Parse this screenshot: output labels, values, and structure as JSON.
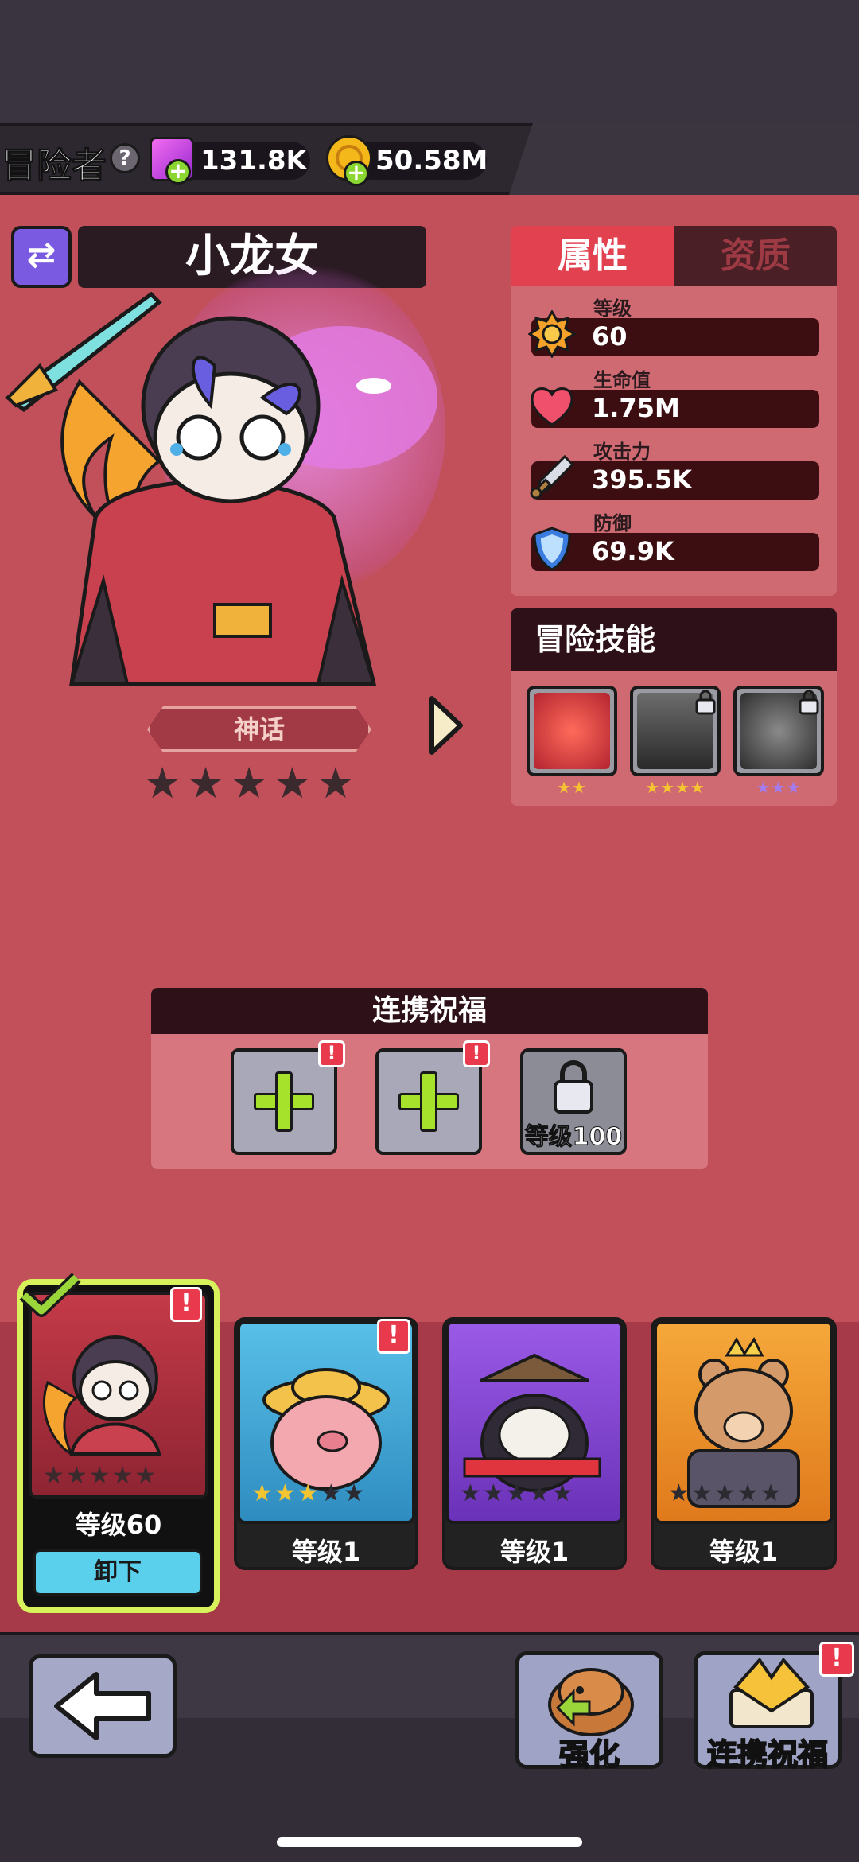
{
  "topbar": {
    "role_label": "冒险者",
    "help_icon": "help-icon",
    "gems": "131.8K",
    "gold": "50.58M"
  },
  "hero": {
    "name": "小龙女",
    "rarity": "神话",
    "stars_total": 5,
    "stars_filled": 0
  },
  "stats": {
    "tabs": [
      "属性",
      "资质"
    ],
    "active_tab": "属性",
    "items": [
      {
        "label": "等级",
        "value": "60",
        "icon": "level-badge-icon"
      },
      {
        "label": "生命值",
        "value": "1.75M",
        "icon": "heart-icon"
      },
      {
        "label": "攻击力",
        "value": "395.5K",
        "icon": "sword-icon"
      },
      {
        "label": "防御",
        "value": "69.9K",
        "icon": "shield-icon"
      }
    ]
  },
  "skills": {
    "title": "冒险技能",
    "items": [
      {
        "name": "dragon-skill",
        "locked": false,
        "stars": 2,
        "star_color": "#f5c431"
      },
      {
        "name": "spikes-skill",
        "locked": true,
        "stars": 4,
        "star_color": "#f5c431"
      },
      {
        "name": "bird-skill",
        "locked": true,
        "stars": 3,
        "star_color": "#a27cf0"
      }
    ]
  },
  "synergy": {
    "title": "连携祝福",
    "slots": [
      {
        "type": "add",
        "alert": "!"
      },
      {
        "type": "add",
        "alert": "!"
      },
      {
        "type": "locked",
        "label": "等级100"
      }
    ]
  },
  "roster": [
    {
      "name": "xiaolongnv",
      "level": "等级60",
      "stars_filled": 0,
      "selected": true,
      "alert": "!",
      "action": "卸下",
      "color": "#c43a48"
    },
    {
      "name": "pig",
      "level": "等级1",
      "stars_filled": 3,
      "selected": false,
      "alert": "!",
      "color": "#3fa7d8"
    },
    {
      "name": "panda",
      "level": "等级1",
      "stars_filled": 0,
      "selected": false,
      "color": "#8a4ed6"
    },
    {
      "name": "bear",
      "level": "等级1",
      "stars_filled": 0,
      "selected": false,
      "color": "#f39a2a"
    }
  ],
  "bottom": {
    "back": "back-arrow-icon",
    "upgrade": "强化",
    "synergy": "连携祝福",
    "synergy_alert": "!"
  },
  "colors": {
    "background": "#c2505a",
    "accent_red": "#e24150",
    "gold_star": "#f5c431"
  }
}
